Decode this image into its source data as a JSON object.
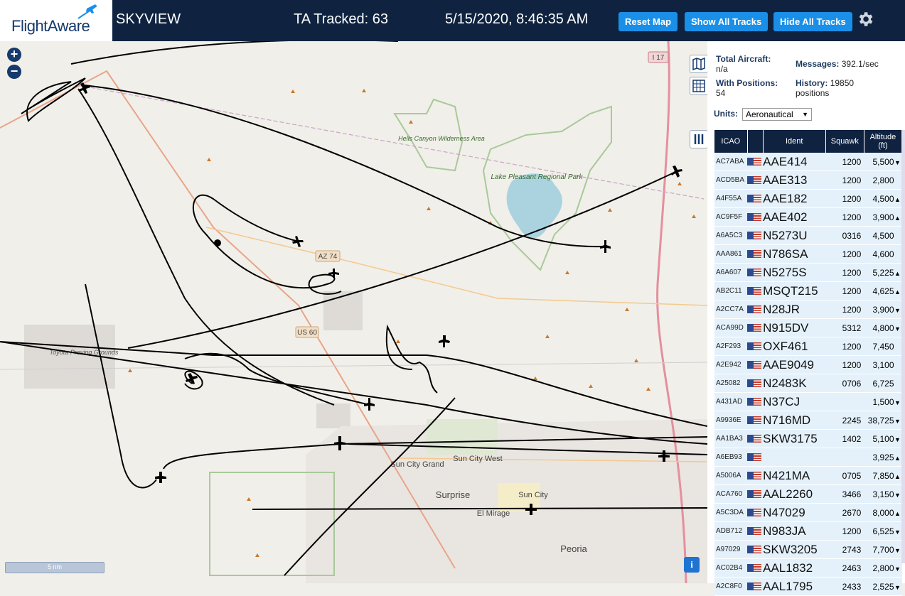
{
  "header": {
    "logo_text": "FlightAware",
    "app_title": "SKYVIEW",
    "tracked": "TA Tracked: 63",
    "datetime": "5/15/2020, 8:46:35 AM",
    "reset_label": "Reset Map",
    "show_label": "Show All Tracks",
    "hide_label": "Hide All Tracks",
    "settings_icon": "gear-icon"
  },
  "map": {
    "zoom_in": "+",
    "zoom_out": "−",
    "scale_label": "5 nm",
    "info_label": "i",
    "place_labels": {
      "hells_canyon": "Hells Canyon Wilderness Area",
      "lake_pleasant": "Lake Pleasant Regional Park",
      "sun_city_grand": "Sun City Grand",
      "sun_city_west": "Sun City West",
      "surprise": "Surprise",
      "sun_city": "Sun City",
      "el_mirage": "El Mirage",
      "peoria": "Peoria",
      "az74": "AZ 74",
      "us60": "US 60",
      "i17": "I 17",
      "proving": "Toyota Proving Grounds"
    }
  },
  "stats": {
    "total_label": "Total Aircraft:",
    "total_value": "n/a",
    "positions_label": "With Positions:",
    "positions_value": "54",
    "messages_label": "Messages:",
    "messages_value": "392.1/sec",
    "history_label": "History:",
    "history_value": "19850",
    "history_unit": "positions"
  },
  "units": {
    "label": "Units:",
    "value": "Aeronautical"
  },
  "table": {
    "headers": {
      "icao": "ICAO",
      "ident": "Ident",
      "squawk": "Squawk",
      "altitude": "Altitude (ft)"
    },
    "rows": [
      {
        "icao": "AC7ABA",
        "ident": "AAE414",
        "squawk": "1200",
        "alt": "5,500",
        "trend": "▼"
      },
      {
        "icao": "ACD5BA",
        "ident": "AAE313",
        "squawk": "1200",
        "alt": "2,800",
        "trend": ""
      },
      {
        "icao": "A4F55A",
        "ident": "AAE182",
        "squawk": "1200",
        "alt": "4,500",
        "trend": "▲"
      },
      {
        "icao": "AC9F5F",
        "ident": "AAE402",
        "squawk": "1200",
        "alt": "3,900",
        "trend": "▲"
      },
      {
        "icao": "A6A5C3",
        "ident": "N5273U",
        "squawk": "0316",
        "alt": "4,500",
        "trend": ""
      },
      {
        "icao": "AAA861",
        "ident": "N786SA",
        "squawk": "1200",
        "alt": "4,600",
        "trend": ""
      },
      {
        "icao": "A6A607",
        "ident": "N5275S",
        "squawk": "1200",
        "alt": "5,225",
        "trend": "▲"
      },
      {
        "icao": "AB2C11",
        "ident": "MSQT215",
        "squawk": "1200",
        "alt": "4,625",
        "trend": "▲"
      },
      {
        "icao": "A2CC7A",
        "ident": "N28JR",
        "squawk": "1200",
        "alt": "3,900",
        "trend": "▼"
      },
      {
        "icao": "ACA99D",
        "ident": "N915DV",
        "squawk": "5312",
        "alt": "4,800",
        "trend": "▼"
      },
      {
        "icao": "A2F293",
        "ident": "OXF461",
        "squawk": "1200",
        "alt": "7,450",
        "trend": ""
      },
      {
        "icao": "A2E942",
        "ident": "AAE9049",
        "squawk": "1200",
        "alt": "3,100",
        "trend": ""
      },
      {
        "icao": "A25082",
        "ident": "N2483K",
        "squawk": "0706",
        "alt": "6,725",
        "trend": ""
      },
      {
        "icao": "A431AD",
        "ident": "N37CJ",
        "squawk": "",
        "alt": "1,500",
        "trend": "▼"
      },
      {
        "icao": "A9936E",
        "ident": "N716MD",
        "squawk": "2245",
        "alt": "38,725",
        "trend": "▼"
      },
      {
        "icao": "AA1BA3",
        "ident": "SKW3175",
        "squawk": "1402",
        "alt": "5,100",
        "trend": "▼"
      },
      {
        "icao": "A6EB93",
        "ident": "",
        "squawk": "",
        "alt": "3,925",
        "trend": "▲"
      },
      {
        "icao": "A5006A",
        "ident": "N421MA",
        "squawk": "0705",
        "alt": "7,850",
        "trend": "▲"
      },
      {
        "icao": "ACA760",
        "ident": "AAL2260",
        "squawk": "3466",
        "alt": "3,150",
        "trend": "▼"
      },
      {
        "icao": "A5C3DA",
        "ident": "N47029",
        "squawk": "2670",
        "alt": "8,000",
        "trend": "▲"
      },
      {
        "icao": "ADB712",
        "ident": "N983JA",
        "squawk": "1200",
        "alt": "6,525",
        "trend": "▼"
      },
      {
        "icao": "A97029",
        "ident": "SKW3205",
        "squawk": "2743",
        "alt": "7,700",
        "trend": "▼"
      },
      {
        "icao": "AC02B4",
        "ident": "AAL1832",
        "squawk": "2463",
        "alt": "2,800",
        "trend": "▼"
      },
      {
        "icao": "A2C8F0",
        "ident": "AAL1795",
        "squawk": "2433",
        "alt": "2,525",
        "trend": "▼"
      }
    ]
  }
}
